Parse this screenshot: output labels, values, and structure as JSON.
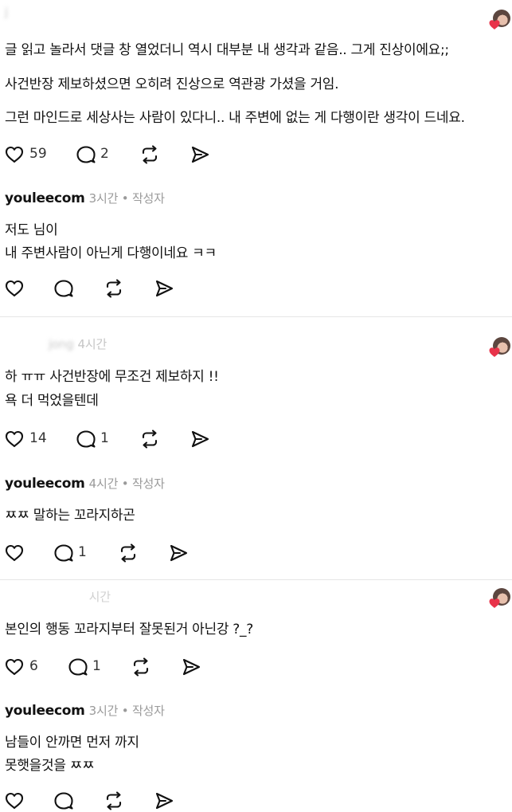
{
  "comment1": {
    "author": "j",
    "lines": [
      "글 읽고 놀라서 댓글 창 열었더니 역시 대부분 내 생각과 같음.. 그게 진상이에요;;",
      "사건반장 제보하셨으면 오히려 진상으로 역관광 가셨을 거임.",
      "그런 마인드로 세상사는 사람이 있다니.. 내 주변에 없는 게 다행이란 생각이 드네요."
    ],
    "likes": "59",
    "replies": "2"
  },
  "reply1": {
    "author": "youleecom",
    "meta": "3시간 • 작성자",
    "lines": [
      "저도 님이",
      "내 주변사람이 아닌게 다행이네요 ㅋㅋ"
    ]
  },
  "comment2": {
    "author": "jong",
    "time": "4시간",
    "lines": [
      "하 ㅠㅠ 사건반장에 무조건 제보하지 !!",
      "욕 더 먹었을텐데"
    ],
    "likes": "14",
    "replies": "1"
  },
  "reply2": {
    "author": "youleecom",
    "meta": "4시간 • 작성자",
    "lines": [
      "ㅉㅉ 말하는 꼬라지하곤"
    ],
    "replies": "1"
  },
  "comment3": {
    "time": "시간",
    "lines": [
      "본인의 행동 꼬라지부터 잘못된거 아닌강 ?_?"
    ],
    "likes": "6",
    "replies": "1"
  },
  "reply3": {
    "author": "youleecom",
    "meta": "3시간 • 작성자",
    "lines": [
      "남들이 안까면 먼저 까지",
      "못햇을것을 ㅉㅉ"
    ]
  },
  "icons": {
    "like": "heart-outline-icon",
    "reply": "speech-bubble-icon",
    "repost": "repost-icon",
    "share": "send-icon"
  },
  "colors": {
    "accent_heart": "#e8334a",
    "meta_gray": "#9a9a9a",
    "divider": "#e6e6e6"
  }
}
